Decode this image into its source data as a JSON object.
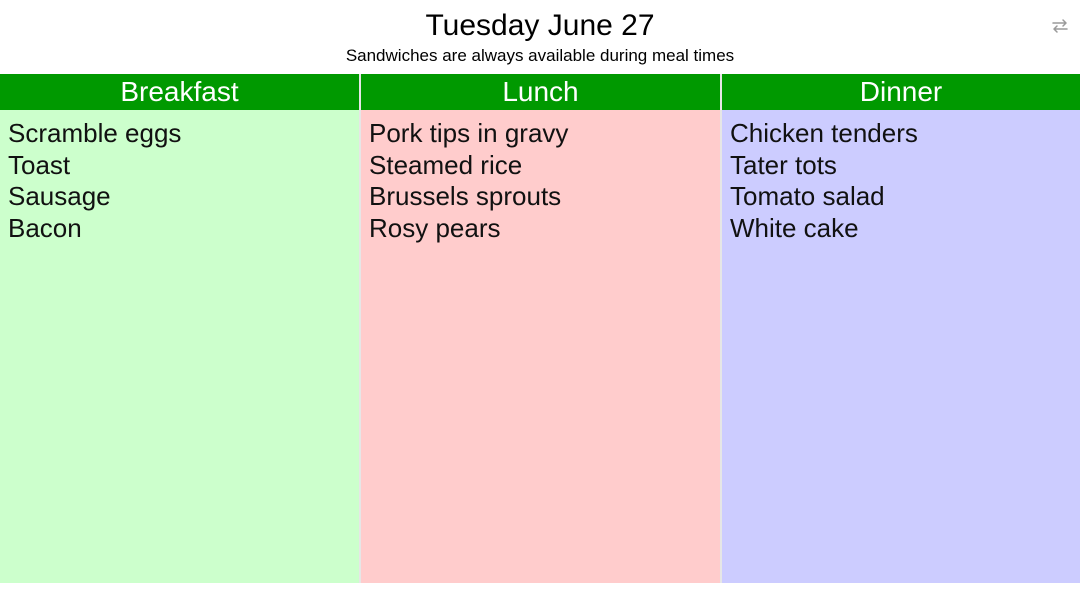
{
  "header": {
    "title": "Tuesday June 27",
    "subtitle": "Sandwiches are always available during meal times",
    "refresh_icon": "refresh-icon"
  },
  "colors": {
    "header_green": "#009900",
    "breakfast_bg": "#ccffcc",
    "lunch_bg": "#ffcccc",
    "dinner_bg": "#ccccff"
  },
  "meals": [
    {
      "name": "Breakfast",
      "items": [
        "Scramble eggs",
        "Toast",
        "Sausage",
        "Bacon"
      ]
    },
    {
      "name": "Lunch",
      "items": [
        "Pork tips in gravy",
        "Steamed rice",
        "Brussels sprouts",
        "Rosy pears"
      ]
    },
    {
      "name": "Dinner",
      "items": [
        "Chicken tenders",
        "Tater tots",
        "Tomato salad",
        "White cake"
      ]
    }
  ]
}
